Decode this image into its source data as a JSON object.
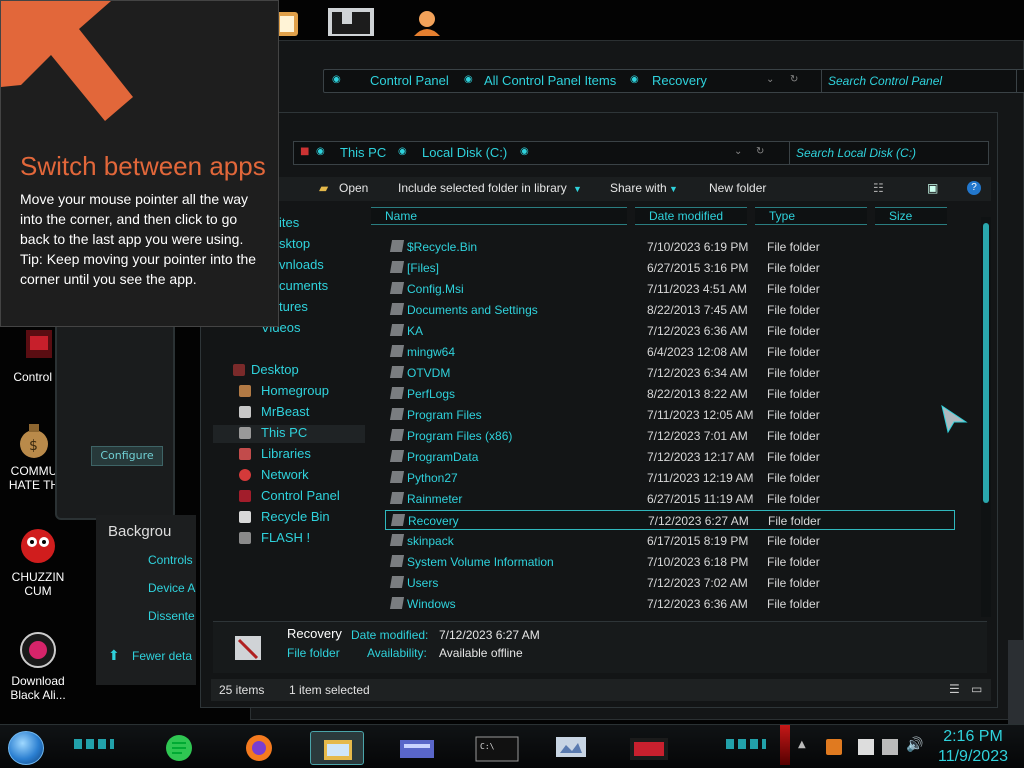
{
  "tooltip": {
    "title": "Switch between apps",
    "body": "Move your mouse pointer all the way into the corner, and then click to go back to the last app you were using.",
    "tip": "Tip: Keep moving your pointer into the corner until you see the app."
  },
  "colors": {
    "accent": "#2fd2dc",
    "tip_title": "#e2673a",
    "arrow": "#e2673a"
  },
  "desktop_icons": [
    {
      "label": "Control F"
    },
    {
      "label": "COMMU HATE TH"
    },
    {
      "label": "CHUZZIN CUM"
    },
    {
      "label": "Download Black Ali..."
    }
  ],
  "control_panel": {
    "breadcrumb": [
      "Control Panel",
      "All Control Panel Items",
      "Recovery"
    ],
    "search_placeholder": "Search Control Panel",
    "configure_label": "Configure",
    "background_heading": "Backgrou",
    "bg_items": [
      "Controls",
      "Device A",
      "Dissente"
    ],
    "fewer_details": "Fewer deta"
  },
  "explorer": {
    "breadcrumb": [
      "This PC",
      "Local Disk (C:)"
    ],
    "search_placeholder": "Search Local Disk (C:)",
    "toolbar": {
      "open": "Open",
      "include": "Include selected folder in library",
      "share": "Share with",
      "new_folder": "New folder"
    },
    "nav_top": [
      "ites",
      "sktop",
      "vnloads",
      "cuments",
      "tures",
      "Videos"
    ],
    "nav": [
      {
        "label": "Desktop",
        "icon": "desktop-icon"
      },
      {
        "label": "Homegroup",
        "icon": "homegroup-icon"
      },
      {
        "label": "MrBeast",
        "icon": "user-icon"
      },
      {
        "label": "This PC",
        "icon": "computer-icon",
        "selected": true
      },
      {
        "label": "Libraries",
        "icon": "libraries-icon"
      },
      {
        "label": "Network",
        "icon": "network-icon"
      },
      {
        "label": "Control Panel",
        "icon": "control-panel-icon"
      },
      {
        "label": "Recycle Bin",
        "icon": "recycle-bin-icon"
      },
      {
        "label": "FLASH !",
        "icon": "flash-icon"
      }
    ],
    "columns": [
      "Name",
      "Date modified",
      "Type",
      "Size"
    ],
    "files": [
      {
        "name": "$Recycle.Bin",
        "date": "7/10/2023 6:19 PM",
        "type": "File folder"
      },
      {
        "name": "[Files]",
        "date": "6/27/2015 3:16 PM",
        "type": "File folder"
      },
      {
        "name": "Config.Msi",
        "date": "7/11/2023 4:51 AM",
        "type": "File folder"
      },
      {
        "name": "Documents and Settings",
        "date": "8/22/2013 7:45 AM",
        "type": "File folder"
      },
      {
        "name": "KA",
        "date": "7/12/2023 6:36 AM",
        "type": "File folder"
      },
      {
        "name": "mingw64",
        "date": "6/4/2023 12:08 AM",
        "type": "File folder"
      },
      {
        "name": "OTVDM",
        "date": "7/12/2023 6:34 AM",
        "type": "File folder"
      },
      {
        "name": "PerfLogs",
        "date": "8/22/2013 8:22 AM",
        "type": "File folder"
      },
      {
        "name": "Program Files",
        "date": "7/11/2023 12:05 AM",
        "type": "File folder"
      },
      {
        "name": "Program Files (x86)",
        "date": "7/12/2023 7:01 AM",
        "type": "File folder"
      },
      {
        "name": "ProgramData",
        "date": "7/12/2023 12:17 AM",
        "type": "File folder"
      },
      {
        "name": "Python27",
        "date": "7/11/2023 12:19 AM",
        "type": "File folder"
      },
      {
        "name": "Rainmeter",
        "date": "6/27/2015 11:19 AM",
        "type": "File folder"
      },
      {
        "name": "Recovery",
        "date": "7/12/2023 6:27 AM",
        "type": "File folder",
        "selected": true
      },
      {
        "name": "skinpack",
        "date": "6/17/2015 8:19 PM",
        "type": "File folder"
      },
      {
        "name": "System Volume Information",
        "date": "7/10/2023 6:18 PM",
        "type": "File folder"
      },
      {
        "name": "Users",
        "date": "7/12/2023 7:02 AM",
        "type": "File folder"
      },
      {
        "name": "Windows",
        "date": "7/12/2023 6:36 AM",
        "type": "File folder"
      }
    ],
    "details": {
      "name": "Recovery",
      "date_label": "Date modified:",
      "date_value": "7/12/2023 6:27 AM",
      "type": "File folder",
      "avail_label": "Availability:",
      "avail_value": "Available offline"
    },
    "status": {
      "items": "25 items",
      "selected": "1 item selected"
    }
  },
  "taskbar": {
    "apps": [
      "spotify-icon",
      "firefox-icon",
      "explorer-icon",
      "control-panel-icon",
      "cmd-icon",
      "monitor-icon",
      "media-icon"
    ],
    "clock": {
      "time": "2:16 PM",
      "date": "11/9/2023"
    }
  }
}
